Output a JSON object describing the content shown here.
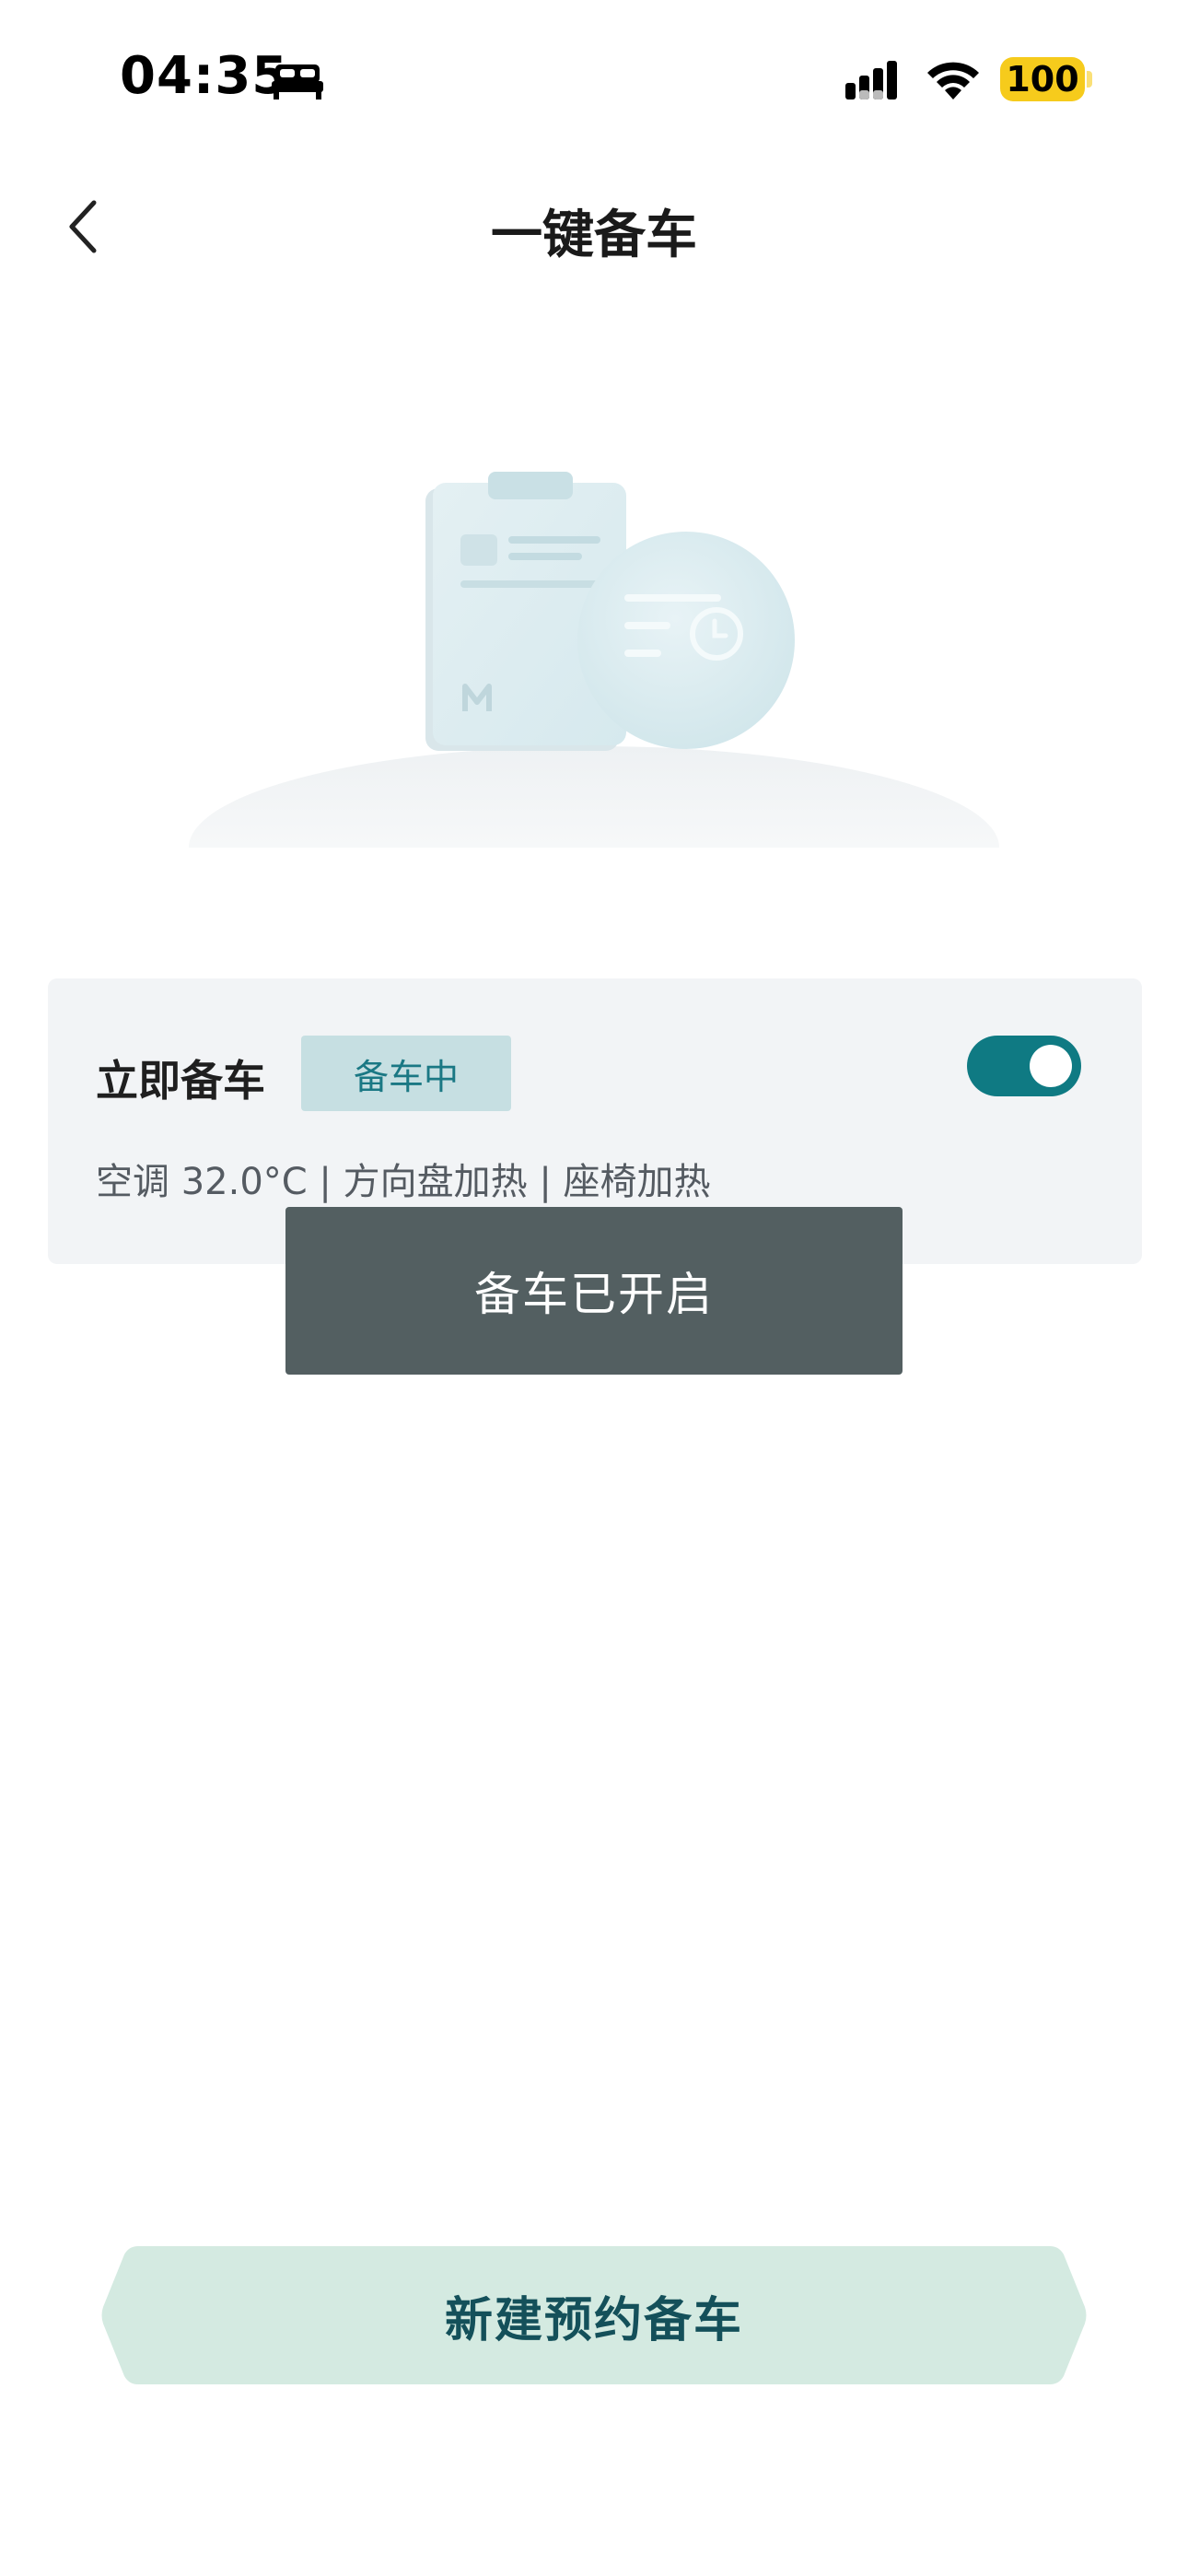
{
  "status_bar": {
    "time": "04:35",
    "battery": "100",
    "icons": [
      "sleep-icon",
      "signal-icon",
      "wifi-icon",
      "battery-icon"
    ]
  },
  "nav": {
    "title": "一键备车",
    "back_icon": "chevron-left-icon"
  },
  "card": {
    "title": "立即备车",
    "badge": "备车中",
    "toggle_on": true,
    "detail": "空调 32.0°C | 方向盘加热 | 座椅加热"
  },
  "toast": {
    "message": "备车已开启"
  },
  "footer": {
    "new_reservation_label": "新建预约备车"
  },
  "colors": {
    "accent": "#0f7a83",
    "badge_bg": "#c6dfe2",
    "badge_text": "#1a7884",
    "card_bg": "#f2f4f6",
    "toast_bg": "#535f61",
    "button_bg": "#d4eae1",
    "button_text": "#14505a",
    "battery": "#f6cb1c"
  }
}
